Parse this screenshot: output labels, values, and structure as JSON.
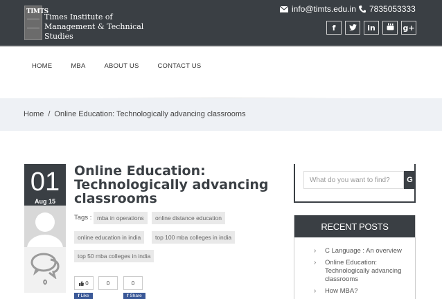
{
  "header": {
    "institute_name": "Times Institute of Management & Technical Studies",
    "logo_text": "TIMTS",
    "email": "info@timts.edu.in",
    "phone": "7835053333",
    "social": [
      {
        "icon": "facebook-icon",
        "glyph": "f"
      },
      {
        "icon": "twitter-icon",
        "glyph": "t"
      },
      {
        "icon": "linkedin-icon",
        "glyph": "in"
      },
      {
        "icon": "youtube-icon",
        "glyph": "▶"
      },
      {
        "icon": "google-plus-icon",
        "glyph": "g+"
      }
    ]
  },
  "nav": {
    "items": [
      "HOME",
      "MBA",
      "ABOUT US",
      "CONTACT US"
    ]
  },
  "breadcrumb": {
    "home": "Home",
    "separator": "/",
    "current": "Online Education: Technologically advancing classrooms"
  },
  "post": {
    "day": "01",
    "month": "Aug 15",
    "comment_count": "0",
    "title": "Online Education: Technologically advancing classrooms",
    "tags_label": "Tags :",
    "tags": [
      "mba in operations",
      "online distance education",
      "online education in india",
      "top 100 mba colleges in india",
      "top 50 mba colleges in india"
    ],
    "share_counts": [
      "0",
      "0",
      "0"
    ],
    "fb_like": "Like",
    "fb_share": "Share"
  },
  "sidebar": {
    "search_placeholder": "What do you want to find?",
    "search_button": "G",
    "recent_title": "RECENT POSTS",
    "recent_posts": [
      "C Language : An overview",
      "Online Education: Technologically advancing classrooms",
      "How MBA?"
    ]
  },
  "colors": {
    "dark": "#3a3f44",
    "band": "#eef1f5",
    "facebook": "#3b5998"
  }
}
